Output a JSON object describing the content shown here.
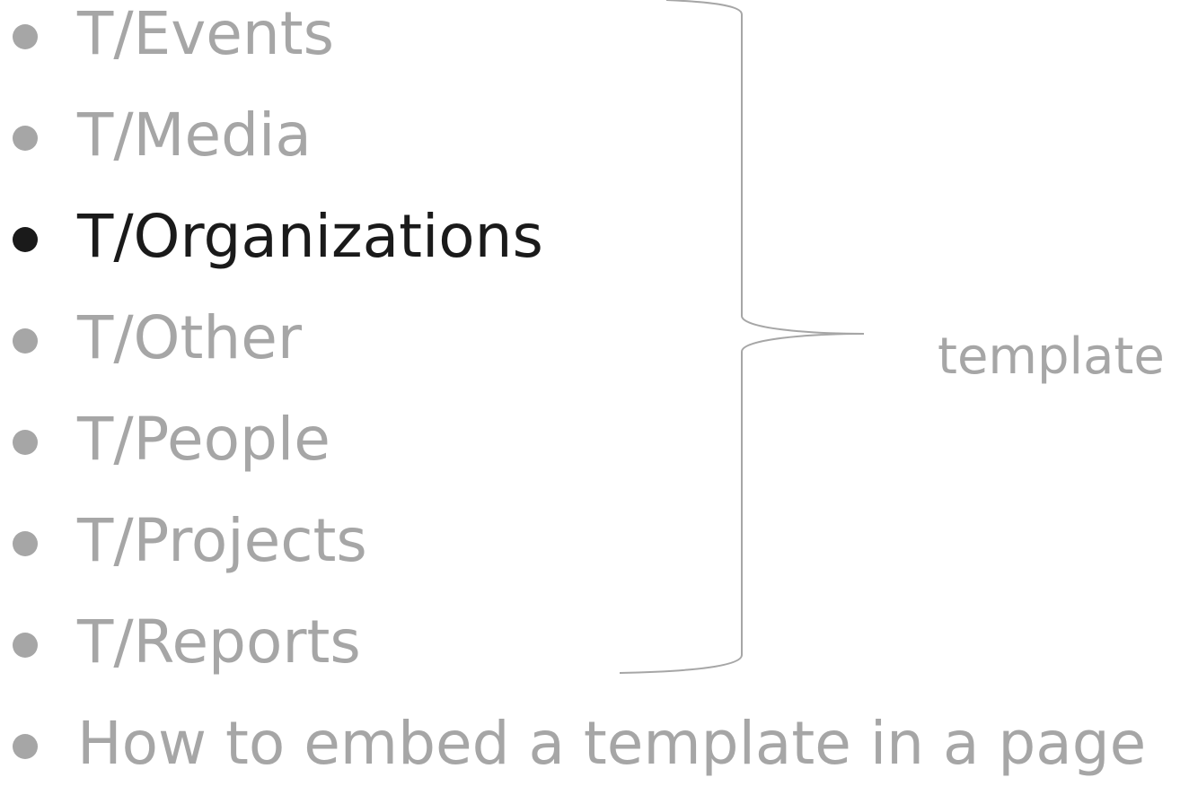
{
  "items": [
    {
      "label": "T/Events",
      "active": false
    },
    {
      "label": "T/Media",
      "active": false
    },
    {
      "label": "T/Organizations",
      "active": true
    },
    {
      "label": "T/Other",
      "active": false
    },
    {
      "label": "T/People",
      "active": false
    },
    {
      "label": "T/Projects",
      "active": false
    },
    {
      "label": "T/Reports",
      "active": false
    },
    {
      "label": "How to embed a template in a page",
      "active": false
    }
  ],
  "brace": {
    "label": "template"
  },
  "colors": {
    "inactive_text": "#a6a6a6",
    "active_text": "#1a1a1a",
    "brace_stroke": "#a6a6a6"
  }
}
